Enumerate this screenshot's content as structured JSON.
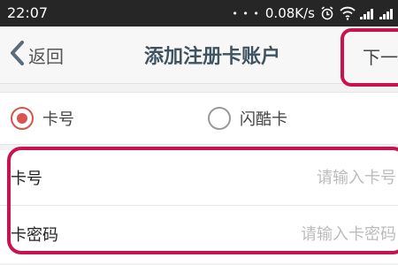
{
  "statusbar": {
    "time": "22:07",
    "signal_dots": "• • •",
    "net_speed": "0.08K/s"
  },
  "navbar": {
    "back_label": "返回",
    "title": "添加注册卡账户",
    "next_label": "下一步"
  },
  "card_type": {
    "options": [
      {
        "label": "卡号",
        "selected": true
      },
      {
        "label": "闪酷卡",
        "selected": false
      }
    ]
  },
  "form": {
    "card_number": {
      "label": "卡号",
      "placeholder": "请输入卡号"
    },
    "card_password": {
      "label": "卡密码",
      "placeholder": "请输入卡密码"
    }
  },
  "colors": {
    "highlight": "#c8134e",
    "radio_selected": "#d9534f",
    "title": "#3f5360"
  }
}
